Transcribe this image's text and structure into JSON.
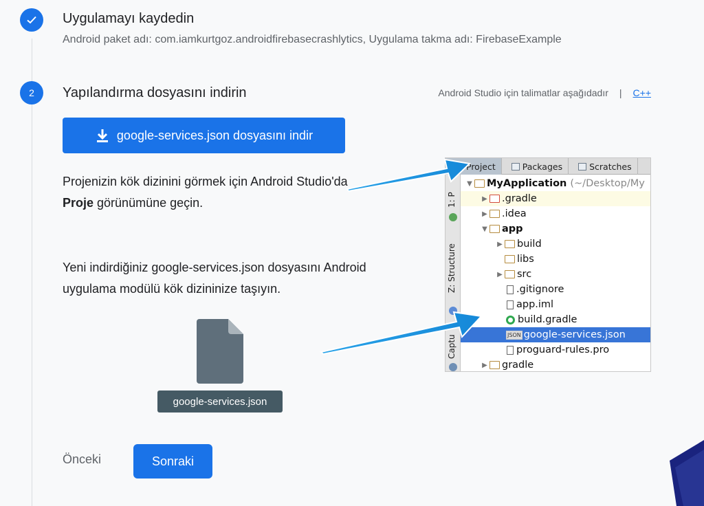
{
  "step1": {
    "title": "Uygulamayı kaydedin",
    "subtitle": "Android paket adı: com.iamkurtgoz.androidfirebasecrashlytics, Uygulama takma adı: FirebaseExample"
  },
  "step2": {
    "number": "2",
    "title": "Yapılandırma dosyasını indirin",
    "instructions_text": "Android Studio için talimatlar aşağıdadır",
    "separator": "|",
    "cpp_link": "C++",
    "download_button": "google-services.json dosyasını indir",
    "para1_prefix": "Projenizin kök dizinini görmek için Android Studio'da ",
    "para1_bold": "Proje",
    "para1_suffix": " görünümüne geçin.",
    "para2": "Yeni indirdiğiniz google-services.json dosyasını Android uygulama modülü kök dizininize taşıyın.",
    "file_chip": "google-services.json"
  },
  "ide": {
    "tabs": [
      "Project",
      "Packages",
      "Scratches"
    ],
    "side_labels": [
      "1: P",
      "Z: Structure",
      "Captu"
    ],
    "tree": [
      {
        "label": "MyApplication",
        "suffix": "(~/Desktop/My",
        "arrow": "▼",
        "icon": "module",
        "bold": true
      },
      {
        "label": ".gradle",
        "arrow": "▶",
        "icon": "folder-red"
      },
      {
        "label": ".idea",
        "arrow": "▶",
        "icon": "folder"
      },
      {
        "label": "app",
        "arrow": "▼",
        "icon": "module",
        "bold": true
      },
      {
        "label": "build",
        "arrow": "▶",
        "icon": "folder"
      },
      {
        "label": "libs",
        "arrow": "",
        "icon": "folder"
      },
      {
        "label": "src",
        "arrow": "▶",
        "icon": "folder"
      },
      {
        "label": ".gitignore",
        "arrow": "",
        "icon": "file"
      },
      {
        "label": "app.iml",
        "arrow": "",
        "icon": "file"
      },
      {
        "label": "build.gradle",
        "arrow": "",
        "icon": "gradle"
      },
      {
        "label": "google-services.json",
        "arrow": "",
        "icon": "json",
        "json_tag": "JSON"
      },
      {
        "label": "proguard-rules.pro",
        "arrow": "",
        "icon": "file"
      },
      {
        "label": "gradle",
        "arrow": "▶",
        "icon": "folder"
      }
    ]
  },
  "nav": {
    "prev": "Önceki",
    "next": "Sonraki"
  },
  "colors": {
    "primary": "#1a73e8",
    "chip": "#455a64",
    "arrow": "#1e9be6"
  }
}
